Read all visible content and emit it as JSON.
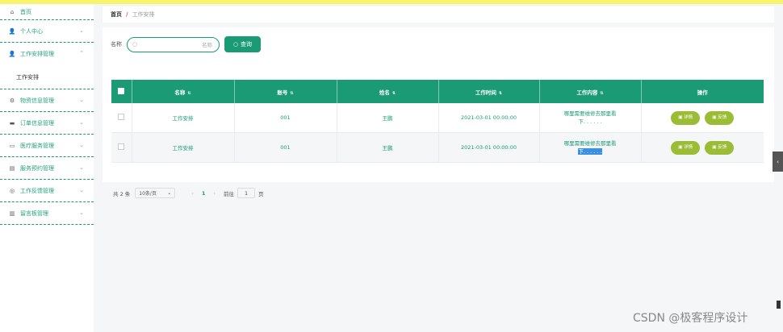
{
  "sidebar": {
    "home": "首页",
    "items": [
      {
        "label": "个人中心",
        "icon": "user-icon"
      },
      {
        "label": "工作安排管理",
        "icon": "user-icon"
      },
      {
        "label": "物资信息管理",
        "icon": "gear-icon"
      },
      {
        "label": "订单信息管理",
        "icon": "chat-icon"
      },
      {
        "label": "医疗服务管理",
        "icon": "chat-icon"
      },
      {
        "label": "服务预约管理",
        "icon": "clipboard-icon"
      },
      {
        "label": "工作反馈管理",
        "icon": "compass-icon"
      },
      {
        "label": "留言板管理",
        "icon": "chart-icon"
      }
    ],
    "submenu_active": "工作安排"
  },
  "breadcrumb": {
    "home": "首页",
    "sep": "/",
    "current": "工作安排"
  },
  "search": {
    "label": "名称",
    "placeholder": "名称",
    "button": "查询"
  },
  "table": {
    "headers": [
      "名称",
      "账号",
      "姓名",
      "工作时间",
      "工作内容",
      "操作"
    ],
    "rows": [
      {
        "name": "工作安排",
        "account": "001",
        "person": "王鹏",
        "time": "2021-03-01 00:00:00",
        "content_line1": "哪里需要维修去那里看",
        "content_line2": "下. . . . . .",
        "op1": "详情",
        "op2": "反馈"
      },
      {
        "name": "工作安排",
        "account": "001",
        "person": "王鹏",
        "time": "2021-03-01 00:00:00",
        "content_line1": "哪里需要维修去那里看",
        "content_line2": "下. . . . . .",
        "op1": "详情",
        "op2": "反馈"
      }
    ]
  },
  "pager": {
    "total": "共 2 条",
    "size": "10条/页",
    "page": "1",
    "goto_label": "前往",
    "goto_value": "1",
    "goto_suffix": "页"
  },
  "watermark": "CSDN @极客程序设计",
  "colors": {
    "accent": "#1a9a75",
    "op_button": "#9bbd36",
    "topbar": "#f7f36a"
  }
}
